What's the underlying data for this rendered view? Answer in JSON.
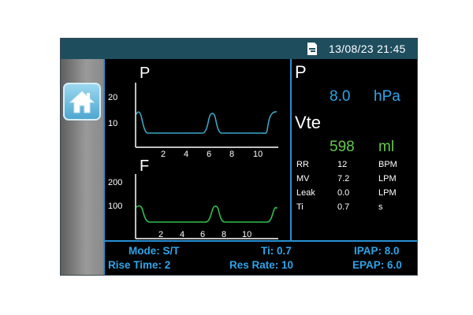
{
  "topbar": {
    "datetime": "13/08/23  21:45",
    "sd_icon": "sd-card-icon"
  },
  "sidebar": {
    "home_icon": "home-icon"
  },
  "graph_pressure": {
    "label": "P",
    "y_ticks": [
      "20",
      "10"
    ],
    "x_ticks": [
      "2",
      "4",
      "6",
      "8",
      "10"
    ],
    "color": "#3aa6c4"
  },
  "graph_flow": {
    "label": "F",
    "y_ticks": [
      "200",
      "100"
    ],
    "x_ticks": [
      "2",
      "4",
      "6",
      "8",
      "10"
    ],
    "color": "#2fbf4f"
  },
  "readings": {
    "pressure": {
      "label": "P",
      "value": "8.0",
      "unit": "hPa"
    },
    "vte": {
      "label": "Vte",
      "value": "598",
      "unit": "ml"
    },
    "rows": [
      {
        "label": "RR",
        "value": "12",
        "unit": "BPM"
      },
      {
        "label": "MV",
        "value": "7.2",
        "unit": "LPM"
      },
      {
        "label": "Leak",
        "value": "0.0",
        "unit": "LPM"
      },
      {
        "label": "Ti",
        "value": "0.7",
        "unit": "s"
      }
    ]
  },
  "settings": {
    "mode": "Mode: S/T",
    "rise_time": "Rise Time: 2",
    "ti": "Ti: 0.7",
    "res_rate": "Res Rate: 10",
    "ipap": "IPAP: 8.0",
    "epap": "EPAP: 6.0"
  },
  "colors": {
    "accent": "#2ea4e8",
    "topbar": "#1e4d5e",
    "flow_green": "#64c84c"
  }
}
